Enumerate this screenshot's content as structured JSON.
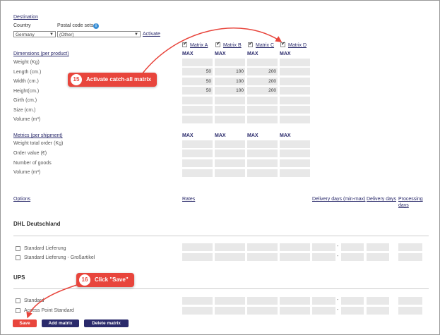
{
  "destination": {
    "title": "Destination",
    "country_label": "Country",
    "postal_label": "Postal code sets",
    "country_value": "Germany",
    "postal_value": "(Other)",
    "activate": "Activate"
  },
  "matrix_headers": [
    "Matrix A",
    "Matrix B",
    "Matrix C",
    "Matrix D"
  ],
  "max_label": "MAX",
  "dimensions": {
    "title": "Dimensions (per product)",
    "rows": [
      "Weight (Kg)",
      "Length (cm.)",
      "Width (cm.)",
      "Height(cm.)",
      "Girth (cm.)",
      "Size (cm.)",
      "Volume (m³)"
    ],
    "values": {
      "length": [
        "50",
        "100",
        "200"
      ],
      "width": [
        "50",
        "100",
        "200"
      ],
      "height": [
        "50",
        "100",
        "200"
      ]
    }
  },
  "metrics": {
    "title": "Metrics (per shipment)",
    "rows": [
      "Weight total order (Kg)",
      "Order value (€)",
      "Number of goods",
      "Volume (m³)"
    ]
  },
  "options_section": {
    "options": "Options",
    "rates": "Rates",
    "delivery_min_max": "Delivery days (min-max)",
    "delivery_days": "Delivery days",
    "processing": "Processing",
    "processing_2": "days"
  },
  "carriers": {
    "dhl": "DHL Deutschland",
    "dhl_items": [
      "Standard Lieferung",
      "Standard Lieferung - Großartikel"
    ],
    "ups": "UPS",
    "ups_items": [
      "Standard",
      "Access Point Standard"
    ]
  },
  "dash": "-",
  "buttons": {
    "save": "Save",
    "add": "Add matrix",
    "delete": "Delete matrix"
  },
  "callouts": {
    "c15_num": "15",
    "c15_text": "Activate catch-all matrix",
    "c16_num": "16",
    "c16_text": "Click \"Save\""
  },
  "colors": {
    "accent": "#e8453c",
    "navy": "#2a2a6b",
    "field": "#e8e8e8"
  }
}
